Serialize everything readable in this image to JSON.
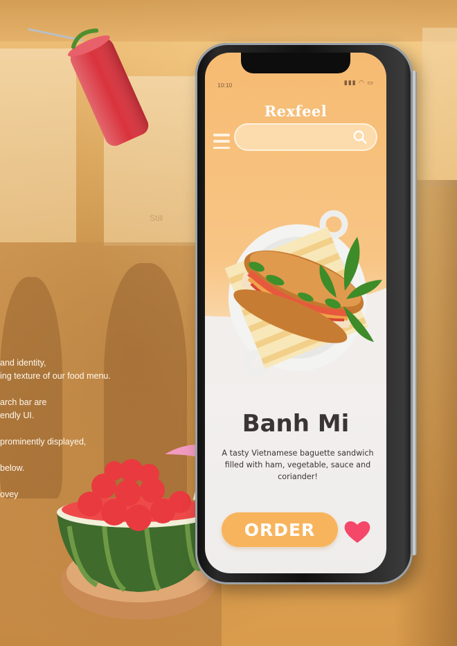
{
  "backdrop": {
    "still_tag": "Still",
    "description_lines": [
      "and identity,",
      "ing texture of our food menu.",
      "",
      "arch bar are",
      "endly UI.",
      "",
      "prominently displayed,",
      "",
      "below.",
      "",
      "ovey"
    ]
  },
  "phone": {
    "status_time": "10:10",
    "status_icons": "▮▮▮ ◠ ▭",
    "logo": "Rexfeel",
    "search": {
      "placeholder": ""
    },
    "dish": {
      "name": "Banh Mi",
      "description": "A tasty Vietnamese baguette sandwich filled with ham, vegetable, sauce and coriander!"
    },
    "order_label": "ORDER",
    "favorite_icon": "heart-icon",
    "colors": {
      "accent": "#f8b45c",
      "heart": "#f5476a",
      "title": "#3a3433",
      "background_top": "#f6bb72",
      "background_bottom": "#efedec"
    }
  }
}
